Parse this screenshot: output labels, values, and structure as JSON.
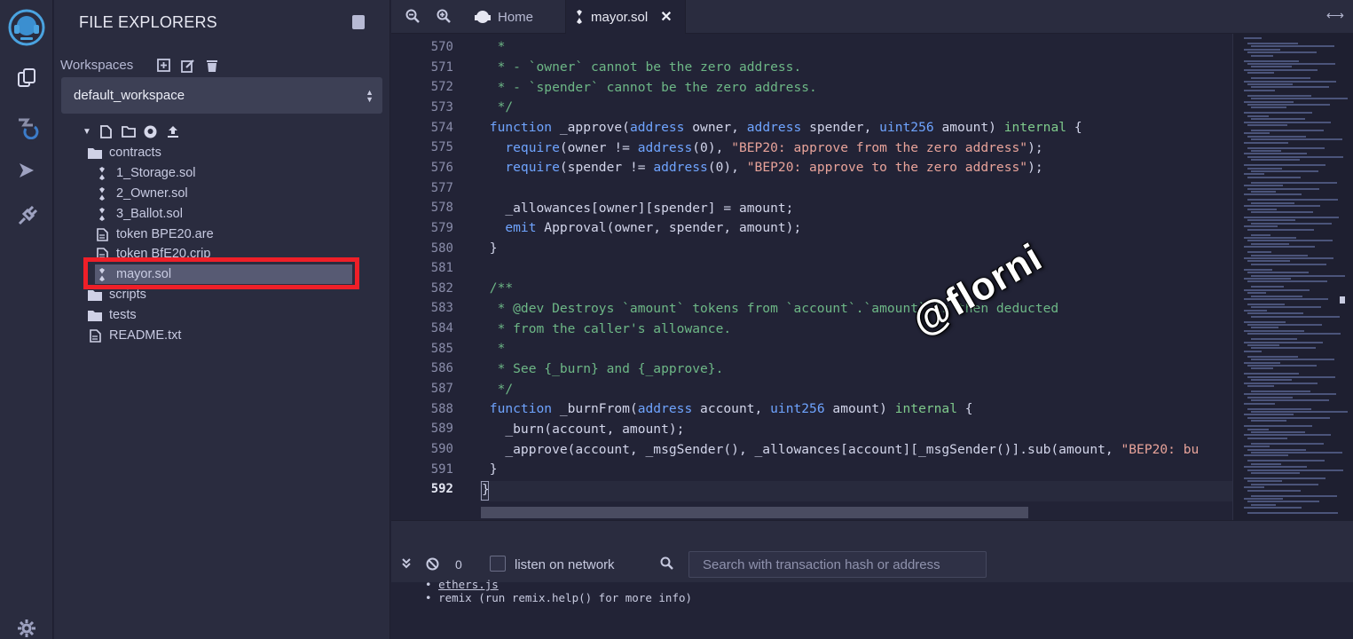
{
  "side_panel": {
    "title": "FILE EXPLORERS",
    "workspaces_label": "Workspaces",
    "workspace_selected": "default_workspace"
  },
  "file_tree": [
    {
      "label": "contracts",
      "type": "folder",
      "indent": 1
    },
    {
      "label": "1_Storage.sol",
      "type": "sol",
      "indent": 2
    },
    {
      "label": "2_Owner.sol",
      "type": "sol",
      "indent": 2
    },
    {
      "label": "3_Ballot.sol",
      "type": "sol",
      "indent": 2
    },
    {
      "label": "token BPE20.are",
      "type": "file",
      "indent": 2
    },
    {
      "label": "token BfE20.crip",
      "type": "file",
      "indent": 2
    },
    {
      "label": "mayor.sol",
      "type": "sol",
      "indent": 2,
      "selected": true
    },
    {
      "label": "scripts",
      "type": "folder",
      "indent": 1
    },
    {
      "label": "tests",
      "type": "folder",
      "indent": 1
    },
    {
      "label": "README.txt",
      "type": "file",
      "indent": 1
    }
  ],
  "tabs": {
    "home_label": "Home",
    "active_label": "mayor.sol"
  },
  "editor": {
    "line_numbers": [
      "570",
      "571",
      "572",
      "573",
      "574",
      "575",
      "576",
      "577",
      "578",
      "579",
      "580",
      "581",
      "582",
      "583",
      "584",
      "585",
      "586",
      "587",
      "588",
      "589",
      "590",
      "591",
      "592"
    ],
    "active_line": "592"
  },
  "watermark": "@florni",
  "terminal": {
    "count": "0",
    "listen_label": "listen on network",
    "search_placeholder": "Search with transaction hash or address",
    "lines": [
      "ethers.js",
      "remix (run remix.help() for more info)"
    ]
  },
  "colors": {
    "highlight_box": "#ef1f28",
    "keyword": "#6fa4ff",
    "string": "#e8a39a",
    "comment": "#6db786"
  }
}
